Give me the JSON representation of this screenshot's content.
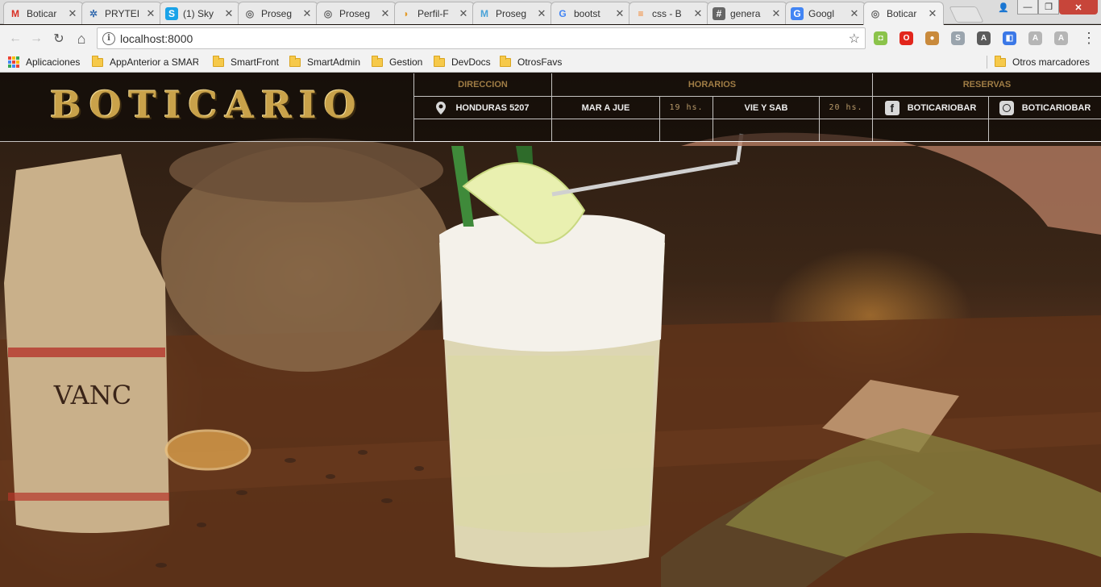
{
  "tabs": [
    {
      "title": "Boticar",
      "icon": "gmail-icon",
      "fav_text": "M",
      "fav_color": "#d93025",
      "fav_bg": "transparent"
    },
    {
      "title": "PRYTEI",
      "icon": "gear-icon",
      "fav_text": "✲",
      "fav_color": "#3a6fb0",
      "fav_bg": "transparent"
    },
    {
      "title": "(1) Sky",
      "icon": "skype-icon",
      "fav_text": "S",
      "fav_color": "#ffffff",
      "fav_bg": "#1aa3e8"
    },
    {
      "title": "Proseg",
      "icon": "globe-icon",
      "fav_text": "◎",
      "fav_color": "#666666",
      "fav_bg": "transparent"
    },
    {
      "title": "Proseg",
      "icon": "globe-icon",
      "fav_text": "◎",
      "fav_color": "#666666",
      "fav_bg": "transparent"
    },
    {
      "title": "Perfil-F",
      "icon": "croissant-icon",
      "fav_text": "◗",
      "fav_color": "#e39b2a",
      "fav_bg": "transparent"
    },
    {
      "title": "Proseg",
      "icon": "m-logo-icon",
      "fav_text": "M",
      "fav_color": "#4aa3d8",
      "fav_bg": "transparent"
    },
    {
      "title": "bootst",
      "icon": "google-icon",
      "fav_text": "G",
      "fav_color": "#4285f4",
      "fav_bg": "transparent"
    },
    {
      "title": "css - B",
      "icon": "stackoverflow-icon",
      "fav_text": "≡",
      "fav_color": "#f48024",
      "fav_bg": "transparent"
    },
    {
      "title": "genera",
      "icon": "hash-icon",
      "fav_text": "#",
      "fav_color": "#ffffff",
      "fav_bg": "#666666"
    },
    {
      "title": "Googl",
      "icon": "google-translate-icon",
      "fav_text": "G",
      "fav_color": "#ffffff",
      "fav_bg": "#4285f4"
    },
    {
      "title": "Boticar",
      "icon": "globe-icon",
      "fav_text": "◎",
      "fav_color": "#666666",
      "fav_bg": "transparent",
      "active": true
    }
  ],
  "tab_close_glyph": "✕",
  "window": {
    "user_glyph": "👤",
    "minimize": "—",
    "maximize": "❐",
    "close": "✕"
  },
  "toolbar": {
    "back": "←",
    "forward": "→",
    "reload": "↻",
    "home": "⌂",
    "info_glyph": "i",
    "url": "localhost:8000",
    "star": "☆",
    "menu": "⋮"
  },
  "extensions": [
    {
      "name": "android-ext-icon",
      "glyph": "◘",
      "bg": "#8bc34a"
    },
    {
      "name": "opera-ext-icon",
      "glyph": "O",
      "bg": "#e2261c"
    },
    {
      "name": "cookie-ext-icon",
      "glyph": "●",
      "bg": "#c98a3c"
    },
    {
      "name": "skype-ext-icon",
      "glyph": "S",
      "bg": "#9aa4ad"
    },
    {
      "name": "angular-ext-icon",
      "glyph": "A",
      "bg": "#5b5b5b"
    },
    {
      "name": "translate-ext-icon",
      "glyph": "◧",
      "bg": "#3b78e7"
    },
    {
      "name": "angular-ext-icon-2",
      "glyph": "A",
      "bg": "#b5b5b5"
    },
    {
      "name": "angular-ext-icon-3",
      "glyph": "A",
      "bg": "#b5b5b5"
    }
  ],
  "bookmarks": {
    "apps": "Aplicaciones",
    "items": [
      "AppAnterior a SMAR",
      "SmartFront",
      "SmartAdmin",
      "Gestion",
      "DevDocs",
      "OtrosFavs"
    ],
    "other": "Otros marcadores"
  },
  "site": {
    "logo": "BOTICARIO",
    "headers": {
      "direccion": "DIRECCION",
      "horarios": "HORARIOS",
      "reservas": "RESERVAS"
    },
    "address": "HONDURAS 5207",
    "days1": "MAR A JUE",
    "hours1": "19 hs.",
    "days2": "VIE Y SAB",
    "hours2": "20 hs.",
    "facebook": "BOTICARIOBAR",
    "instagram": "BOTICARIOBAR",
    "facebook_glyph": "f"
  }
}
